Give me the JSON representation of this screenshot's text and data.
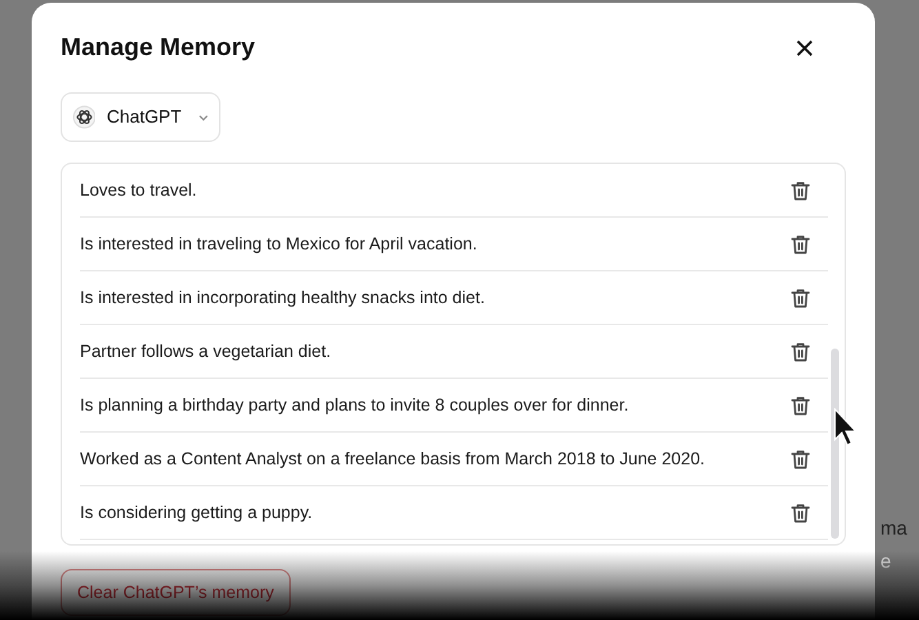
{
  "dialog": {
    "title": "Manage Memory",
    "model_selector": {
      "label": "ChatGPT"
    },
    "memories": [
      {
        "text": "Loves to travel."
      },
      {
        "text": "Is interested in traveling to Mexico for April vacation."
      },
      {
        "text": "Is interested in incorporating healthy snacks into diet."
      },
      {
        "text": "Partner follows a vegetarian diet."
      },
      {
        "text": "Is planning a birthday party and plans to invite 8 couples over for dinner."
      },
      {
        "text": "Worked as a Content Analyst on a freelance basis from March 2018 to June 2020."
      },
      {
        "text": "Is considering getting a puppy."
      }
    ],
    "clear_button": "Clear ChatGPT’s memory"
  },
  "background_text": [
    "ma",
    "e"
  ]
}
